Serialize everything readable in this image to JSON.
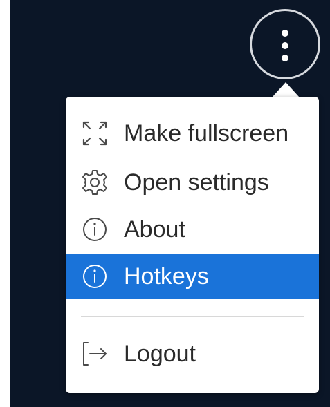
{
  "toolbar": {
    "more_button_icon": "more-vertical-icon"
  },
  "menu": {
    "items": [
      {
        "label": "Make fullscreen",
        "icon": "fullscreen-icon",
        "active": false
      },
      {
        "label": "Open settings",
        "icon": "gear-icon",
        "active": false
      },
      {
        "label": "About",
        "icon": "info-icon",
        "active": false
      },
      {
        "label": "Hotkeys",
        "icon": "info-icon",
        "active": true
      },
      {
        "label": "Logout",
        "icon": "logout-icon",
        "active": false
      }
    ]
  },
  "colors": {
    "backdrop": "#0b1627",
    "accent": "#1a73d9",
    "menu_background": "#ffffff",
    "text": "#2a2a2a"
  }
}
